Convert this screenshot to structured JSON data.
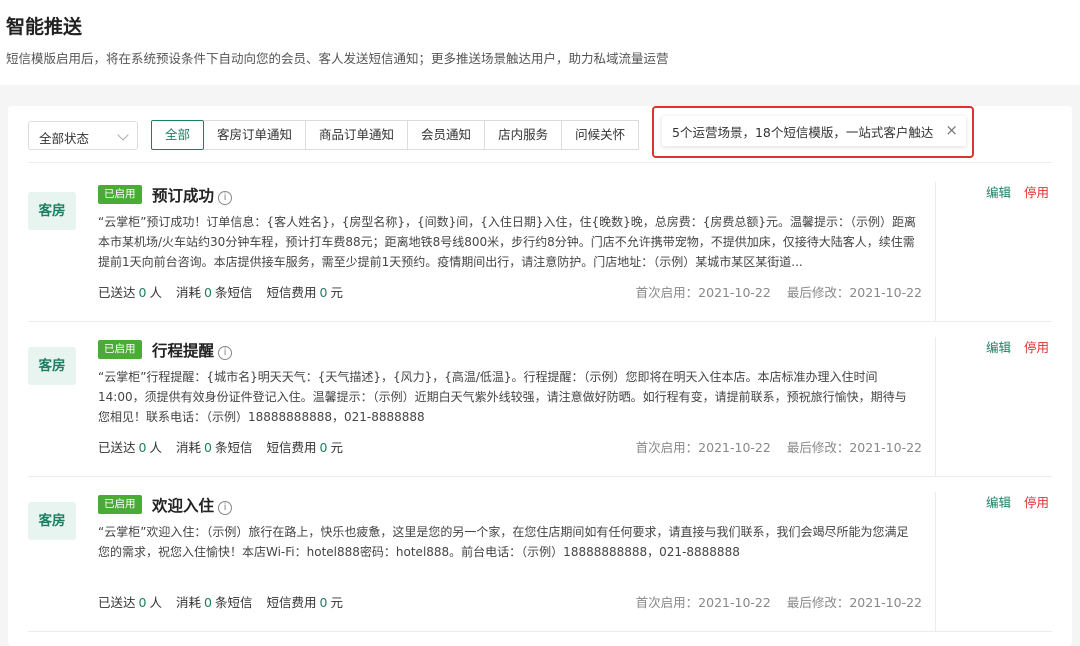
{
  "header": {
    "title": "智能推送",
    "subtitle": "短信模版启用后，将在系统预设条件下自动向您的会员、客人发送短信通知；更多推送场景触达用户，助力私域流量运营"
  },
  "filters": {
    "status_select": "全部状态",
    "tabs": [
      {
        "label": "全部",
        "active": true
      },
      {
        "label": "客房订单通知"
      },
      {
        "label": "商品订单通知"
      },
      {
        "label": "会员通知"
      },
      {
        "label": "店内服务"
      },
      {
        "label": "问候关怀"
      }
    ]
  },
  "tip": {
    "text": "5个运营场景，18个短信模版，一站式客户触达",
    "close": "×"
  },
  "labels": {
    "sent_prefix": "已送达",
    "sent_unit": "人",
    "consume_prefix": "消耗",
    "consume_unit": "条短信",
    "fee_prefix": "短信费用",
    "fee_unit": "元",
    "first_enabled": "首次启用：",
    "last_modified": "最后修改：",
    "edit": "编辑",
    "disable": "停用",
    "enabled_tag": "已启用",
    "info": "i"
  },
  "templates": [
    {
      "category": "客房",
      "title": "预订成功",
      "content": "“云掌柜”预订成功！订单信息：{客人姓名}，{房型名称}，{间数}间，{入住日期}入住，住{晚数}晚，总房费：{房费总额}元。温馨提示：（示例）距离本市某机场/火车站约30分钟车程，预计打车费88元；距离地铁8号线800米，步行约8分钟。门店不允许携带宠物，不提供加床，仅接待大陆客人，续住需提前1天向前台咨询。本店提供接车服务，需至少提前1天预约。疫情期间出行，请注意防护。门店地址：（示例）某城市某区某街道...",
      "sent": "0",
      "consumed": "0",
      "fee": "0",
      "first_enabled": "2021-10-22",
      "last_modified": "2021-10-22"
    },
    {
      "category": "客房",
      "title": "行程提醒",
      "content": "“云掌柜”行程提醒：{城市名}明天天气：{天气描述}，{风力}，{高温/低温}。行程提醒：（示例）您即将在明天入住本店。本店标准办理入住时间14:00，须提供有效身份证件登记入住。温馨提示：（示例）近期白天气紫外线较强，请注意做好防晒。如行程有变，请提前联系，预祝旅行愉快，期待与您相见！联系电话：（示例）18888888888，021-8888888",
      "sent": "0",
      "consumed": "0",
      "fee": "0",
      "first_enabled": "2021-10-22",
      "last_modified": "2021-10-22"
    },
    {
      "category": "客房",
      "title": "欢迎入住",
      "content": "“云掌柜”欢迎入住：（示例）旅行在路上，快乐也疲惫，这里是您的另一个家，在您住店期间如有任何要求，请直接与我们联系，我们会竭尽所能为您满足您的需求，祝您入住愉快！本店Wi-Fi：hotel888密码：hotel888。前台电话：（示例）18888888888，021-8888888",
      "sent": "0",
      "consumed": "0",
      "fee": "0",
      "first_enabled": "2021-10-22",
      "last_modified": "2021-10-22"
    }
  ]
}
